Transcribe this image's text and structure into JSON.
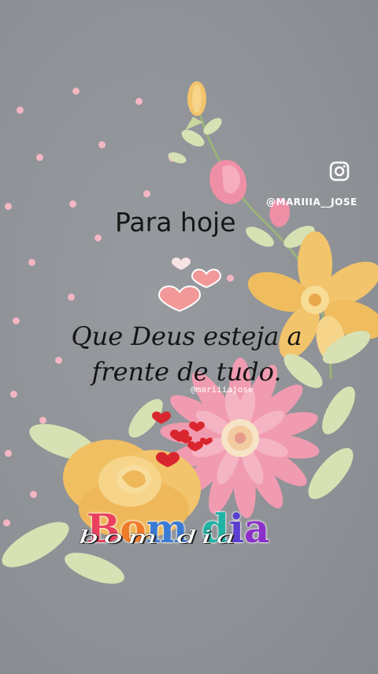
{
  "overlay": {
    "instagram_handle": "@MARIIIA__JOSE",
    "watermark_handle": "@mariiiajose"
  },
  "content": {
    "heading": "Para hoje",
    "message_line1": "Que Deus esteja a",
    "message_line2": "frente de tudo.",
    "greeting_letters": [
      "B",
      "o",
      "m",
      " ",
      "d",
      "i",
      "a"
    ],
    "greeting_colors": [
      "#e8405e",
      "#f07b2a",
      "#3a7bd5",
      "#ffffff",
      "#21b2a6",
      "#5b3fd0",
      "#8b2fc9"
    ],
    "greeting_script": "bom dia"
  },
  "icons": {
    "instagram": "instagram-icon"
  },
  "colors": {
    "background": "#8f9297",
    "dots": "#f3b6c2",
    "flower_yellow": "#f2c46b",
    "flower_pink": "#f19bb0",
    "leaves": "#d9e3b6",
    "hearts": "#d9262e"
  }
}
